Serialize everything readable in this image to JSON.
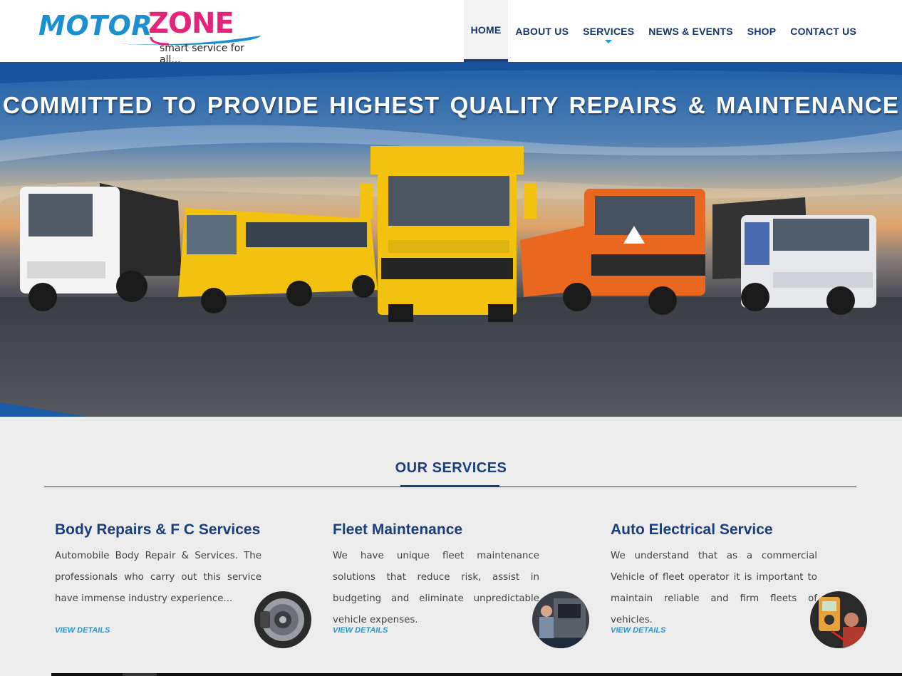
{
  "brand": {
    "logo_part1": "MOTOR",
    "logo_part2": "ZONE",
    "tagline": "smart service for all..."
  },
  "nav": {
    "items": [
      {
        "label": "HOME"
      },
      {
        "label": "ABOUT US"
      },
      {
        "label": "SERVICES"
      },
      {
        "label": "NEWS & EVENTS"
      },
      {
        "label": "SHOP"
      },
      {
        "label": "CONTACT US"
      }
    ]
  },
  "hero": {
    "headline": "COMMITTED TO PROVIDE  HIGHEST QUALITY REPAIRS & MAINTENANCE"
  },
  "services": {
    "title": "OUR SERVICES",
    "cards": [
      {
        "title": "Body Repairs & F C Services",
        "description": "Automobile Body Repair & Services. The professionals who carry out this service have immense industry experience...",
        "link": "VIEW DETAILS"
      },
      {
        "title": "Fleet Maintenance",
        "description": "We have unique fleet maintenance solutions that reduce risk, assist in budgeting and eliminate unpredictable vehicle expenses.",
        "link": "VIEW DETAILS"
      },
      {
        "title": "Auto Electrical Service",
        "description": "We understand that as a commercial Vehicle of fleet operator it is important to maintain reliable and firm fleets of vehicles.",
        "link": "VIEW DETAILS"
      }
    ]
  },
  "colors": {
    "navy": "#1a3f7a",
    "accent_blue": "#1e9ad6",
    "logo_blue": "#1b8fcf",
    "logo_pink": "#e4237b",
    "page_bg": "#ececec"
  },
  "icons": [
    "active-caret-icon",
    "brake-disc-image",
    "mechanic-engine-image",
    "electrical-meter-image"
  ]
}
